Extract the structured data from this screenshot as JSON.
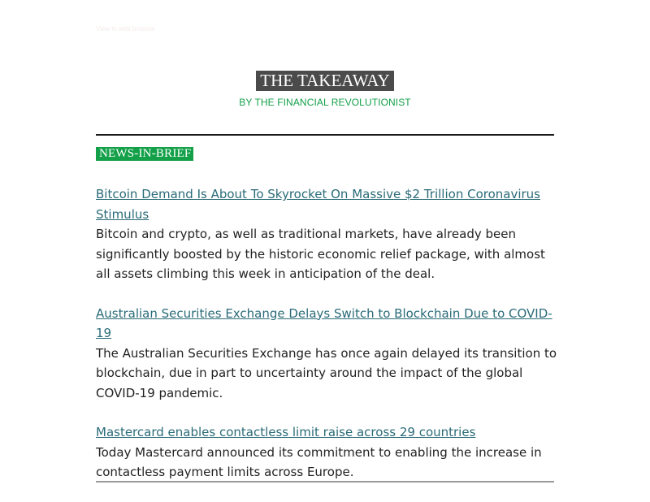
{
  "preheader": "View in web browser",
  "header": {
    "title": "THE TAKEAWAY",
    "byline": "BY THE FINANCIAL REVOLUTIONIST"
  },
  "section": {
    "label": "NEWS-IN-BRIEF"
  },
  "stories": [
    {
      "headline": "Bitcoin Demand Is About To Skyrocket On Massive $2 Trillion Coronavirus Stimulus",
      "summary": "Bitcoin and crypto, as well as traditional markets, have already been significantly boosted by the historic economic relief package, with almost all assets climbing this week in anticipation of the deal."
    },
    {
      "headline": "Australian Securities Exchange Delays Switch to Blockchain Due to COVID-19",
      "summary": "The Australian Securities Exchange has once again delayed its transition to blockchain, due in part to uncertainty around the impact of the global COVID-19 pandemic."
    },
    {
      "headline": "Mastercard enables contactless limit raise across 29 countries",
      "summary": "Today Mastercard announced its commitment to enabling the increase in contactless payment limits across Europe."
    }
  ],
  "colors": {
    "accent_green": "#13a049",
    "title_bg": "#4b4b4b",
    "link": "#2a6b78"
  }
}
